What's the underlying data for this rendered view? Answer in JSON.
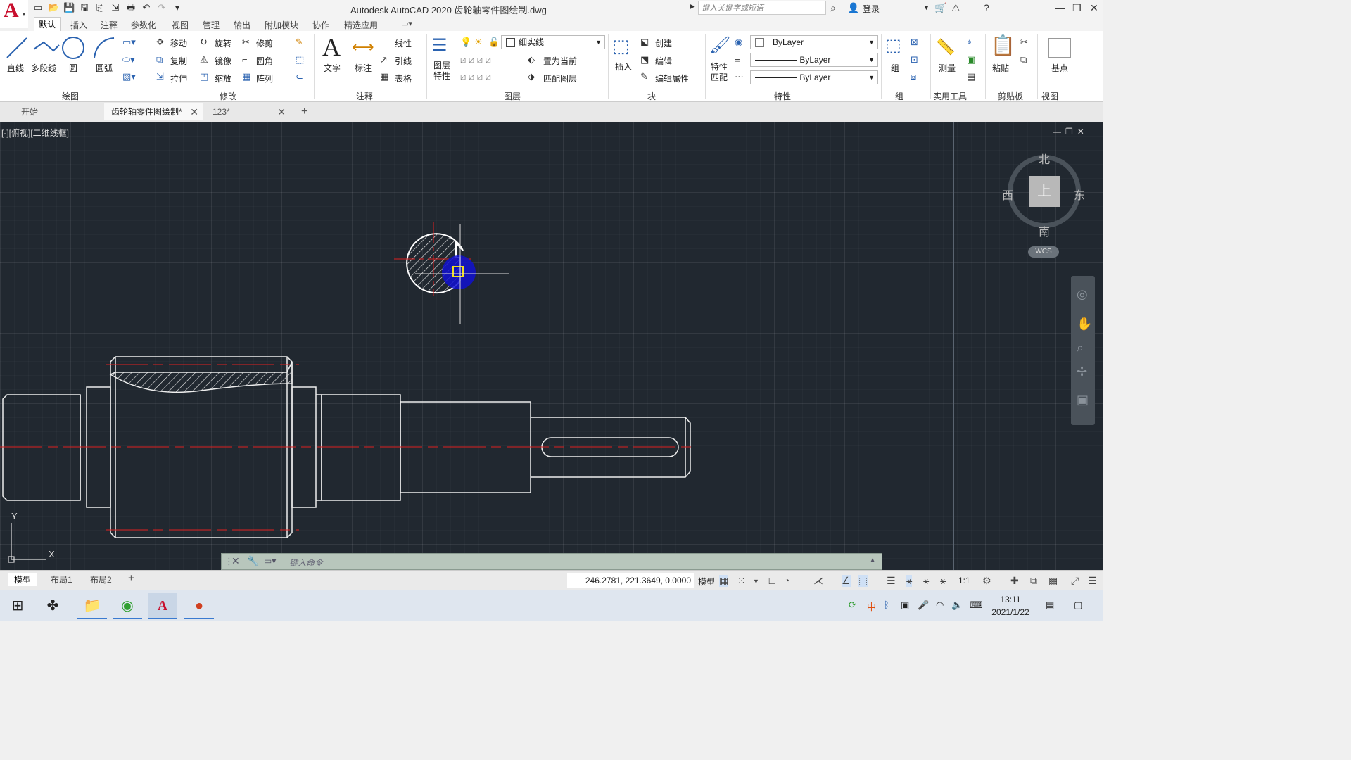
{
  "window": {
    "title": "Autodesk AutoCAD 2020    齿轮轴零件图绘制.dwg",
    "search_placeholder": "键入关键字或短语",
    "login": "登录"
  },
  "ribbon_tabs": [
    "默认",
    "插入",
    "注释",
    "参数化",
    "视图",
    "管理",
    "输出",
    "附加模块",
    "协作",
    "精选应用"
  ],
  "ribbon": {
    "draw": {
      "label": "绘图",
      "line": "直线",
      "polyline": "多段线",
      "circle": "圆",
      "arc": "圆弧"
    },
    "modify": {
      "label": "修改",
      "move": "移动",
      "rotate": "旋转",
      "trim": "修剪",
      "copy": "复制",
      "mirror": "镜像",
      "fillet": "圆角",
      "stretch": "拉伸",
      "scale": "缩放",
      "array": "阵列"
    },
    "annotation": {
      "label": "注释",
      "text": "文字",
      "dimension": "标注",
      "linear": "线性",
      "leader": "引线",
      "table": "表格"
    },
    "layers": {
      "label": "图层",
      "layer_props": "图层\n特性",
      "current_layer": "细实线",
      "set_current": "置为当前",
      "match_layer": "匹配图层"
    },
    "block": {
      "label": "块",
      "insert": "插入",
      "create": "创建",
      "edit": "编辑",
      "edit_attr": "编辑属性"
    },
    "properties": {
      "label": "特性",
      "match": "特性\n匹配",
      "color": "ByLayer",
      "linetype": "ByLayer",
      "lineweight": "ByLayer"
    },
    "groups": {
      "label": "组",
      "group": "组"
    },
    "utilities": {
      "label": "实用工具",
      "measure": "测量"
    },
    "clipboard": {
      "label": "剪贴板",
      "paste": "粘贴"
    },
    "view": {
      "label": "视图",
      "base": "基点"
    }
  },
  "file_tabs": [
    {
      "label": "开始"
    },
    {
      "label": "齿轮轴零件图绘制*"
    },
    {
      "label": "123*"
    }
  ],
  "viewport": {
    "label": "[-][俯视][二维线框]",
    "navcube": {
      "north": "北",
      "south": "南",
      "east": "东",
      "west": "西",
      "top": "上",
      "wcs": "WCS"
    },
    "ucs": {
      "x": "X",
      "y": "Y"
    }
  },
  "command": {
    "placeholder": "键入命令"
  },
  "layout_tabs": [
    "模型",
    "布局1",
    "布局2"
  ],
  "status": {
    "coords": "246.2781, 221.3649, 0.0000",
    "model": "模型",
    "scale": "1:1"
  },
  "taskbar": {
    "time": "13:11",
    "date": "2021/1/22",
    "ime": "中"
  }
}
